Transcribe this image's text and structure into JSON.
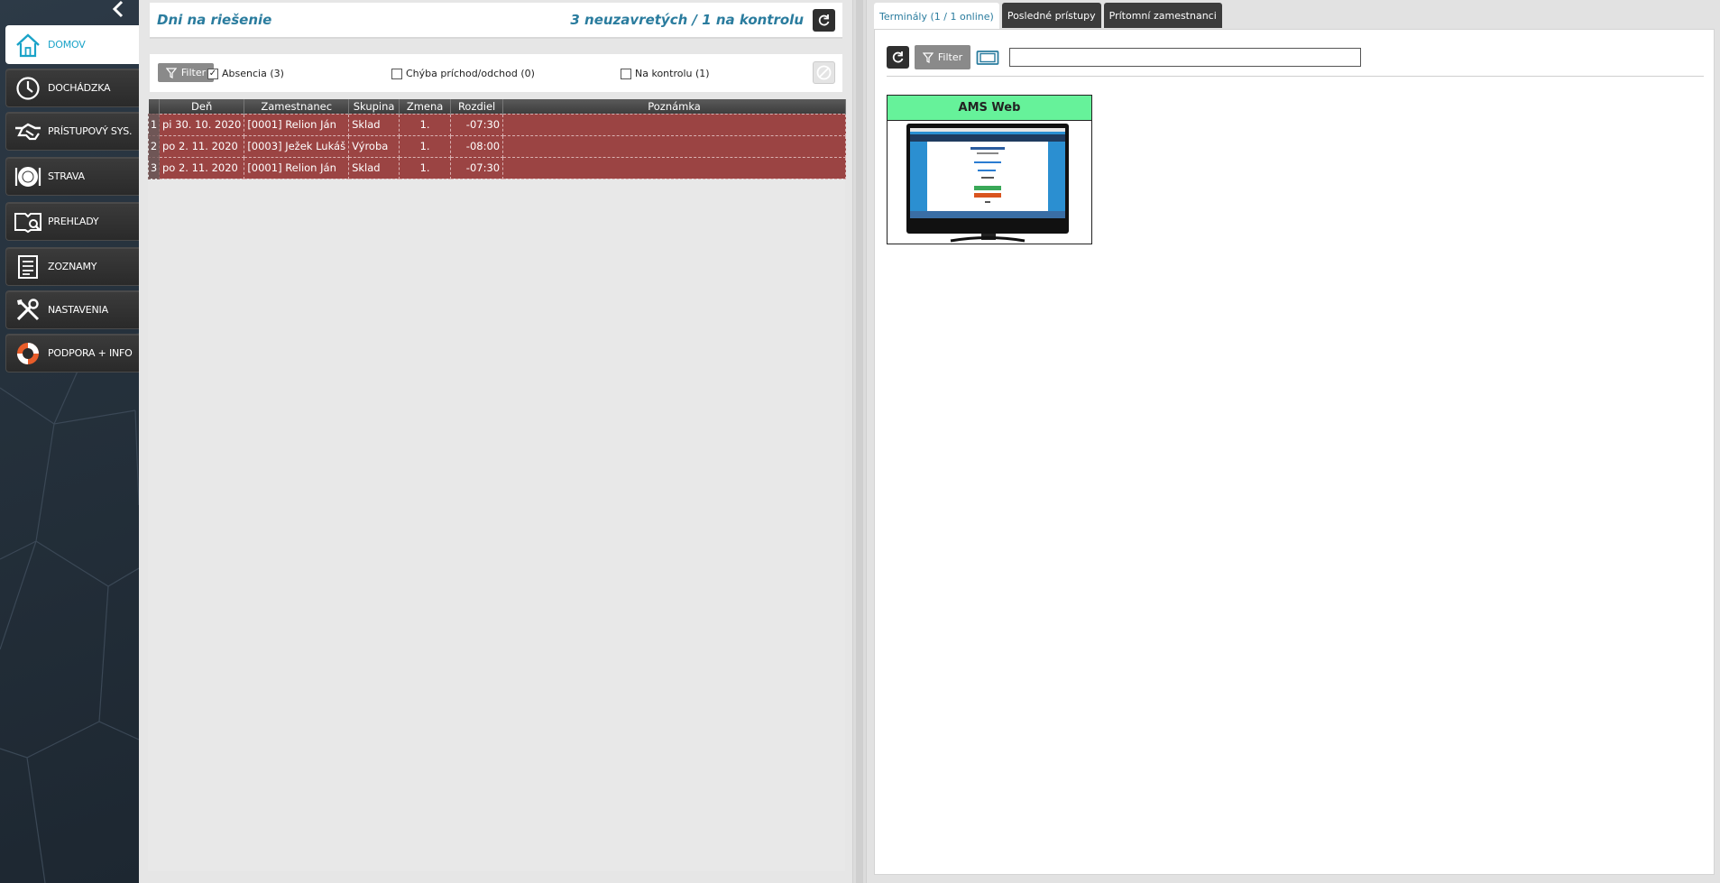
{
  "sidebar": {
    "collapse_icon": "chevron-left-icon",
    "items": [
      {
        "label": "DOMOV",
        "icon": "home-icon",
        "active": true
      },
      {
        "label": "DOCHÁDZKA",
        "icon": "clock-icon"
      },
      {
        "label": "PRÍSTUPOVÝ SYS.",
        "icon": "handshake-icon"
      },
      {
        "label": "STRAVA",
        "icon": "plate-icon"
      },
      {
        "label": "PREHĽADY",
        "icon": "book-search-icon"
      },
      {
        "label": "ZOZNAMY",
        "icon": "list-icon"
      },
      {
        "label": "NASTAVENIA",
        "icon": "tools-icon"
      },
      {
        "label": "PODPORA + INFO",
        "icon": "lifebuoy-icon"
      }
    ]
  },
  "days": {
    "title": "Dni na riešenie",
    "summary": "3 neuzavretých / 1 na kontrolu",
    "filter_label": "Filter",
    "checkboxes": [
      {
        "label": "Absencia (3)",
        "checked": true
      },
      {
        "label": "Chýba príchod/odchod (0)",
        "checked": false
      },
      {
        "label": "Na kontrolu (1)",
        "checked": false
      }
    ],
    "columns": [
      "Deň",
      "Zamestnanec",
      "Skupina",
      "Zmena",
      "Rozdiel",
      "Poznámka"
    ],
    "rows": [
      {
        "n": "1",
        "day": "pi 30. 10. 2020",
        "employee": "[0001] Relion Ján",
        "group": "Sklad",
        "shift": "1.",
        "diff": "-07:30",
        "note": ""
      },
      {
        "n": "2",
        "day": "po 2. 11. 2020",
        "employee": "[0003] Ježek Lukáš",
        "group": "Výroba",
        "shift": "1.",
        "diff": "-08:00",
        "note": ""
      },
      {
        "n": "3",
        "day": "po 2. 11. 2020",
        "employee": "[0001] Relion Ján",
        "group": "Sklad",
        "shift": "1.",
        "diff": "-07:30",
        "note": ""
      }
    ],
    "row_color": "#9b4443"
  },
  "right": {
    "tabs": [
      {
        "label": "Terminály (1 / 1 online)",
        "active": true
      },
      {
        "label": "Posledné prístupy"
      },
      {
        "label": "Prítomní zamestnanci"
      }
    ],
    "filter_label": "Filter",
    "search": {
      "value": "",
      "placeholder": ""
    },
    "terminals": [
      {
        "name": "AMS Web",
        "status_color": "#66f29a",
        "icon": "monitor-icon"
      }
    ]
  },
  "colors": {
    "accent": "#2a7c9e",
    "active_nav_text": "#1aa3c8"
  }
}
